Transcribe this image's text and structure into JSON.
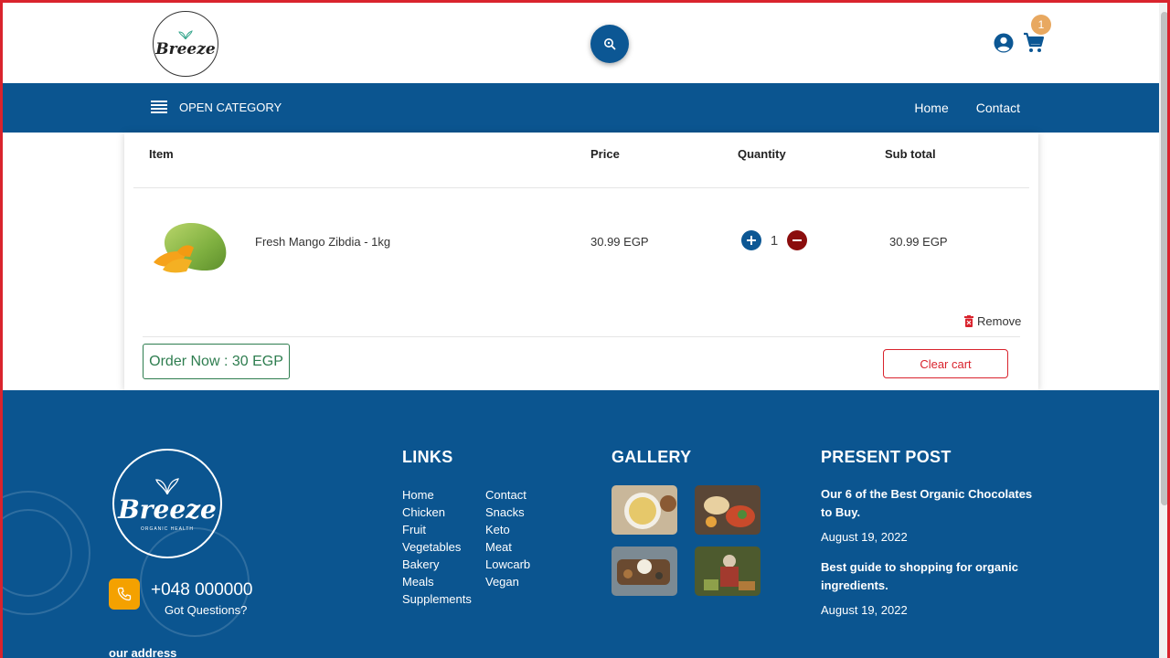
{
  "header": {
    "logo_text": "Breeze",
    "cart_count": "1",
    "icons": [
      "search-icon",
      "user-icon",
      "cart-icon"
    ]
  },
  "nav": {
    "open_category": "OPEN CATEGORY",
    "links": [
      "Home",
      "Contact"
    ]
  },
  "cart": {
    "columns": [
      "Item",
      "Price",
      "Quantity",
      "Sub total"
    ],
    "items": [
      {
        "name": "Fresh Mango Zibdia - 1kg",
        "price": "30.99 EGP",
        "quantity": "1",
        "subtotal": "30.99 EGP"
      }
    ],
    "remove_label": "Remove",
    "order_label": "Order Now : 30 EGP",
    "clear_label": "Clear cart"
  },
  "footer": {
    "logo_text": "Breeze",
    "logo_subtext": "ORGANIC HEALTH",
    "phone": "+048 000000",
    "phone_caption": "Got Questions?",
    "address_label": "our address",
    "links_heading": "LINKS",
    "links_col1": [
      "Home",
      "Chicken",
      "Fruit",
      "Vegetables",
      "Bakery",
      "Meals",
      "Supplements"
    ],
    "links_col2": [
      "Contact",
      "Snacks",
      "Keto",
      "Meat",
      "Lowcarb",
      "Vegan"
    ],
    "gallery_heading": "GALLERY",
    "posts_heading": "PRESENT POST",
    "posts": [
      {
        "title": "Our 6 of the Best Organic Chocolates to Buy.",
        "date": "August 19, 2022"
      },
      {
        "title": "Best guide to shopping for organic ingredients.",
        "date": "August 19, 2022"
      }
    ]
  },
  "colors": {
    "primary": "#0b5590",
    "danger": "#d9232d",
    "success": "#2e7d4f",
    "badge": "#e8a860",
    "phone_accent": "#f4a100"
  }
}
